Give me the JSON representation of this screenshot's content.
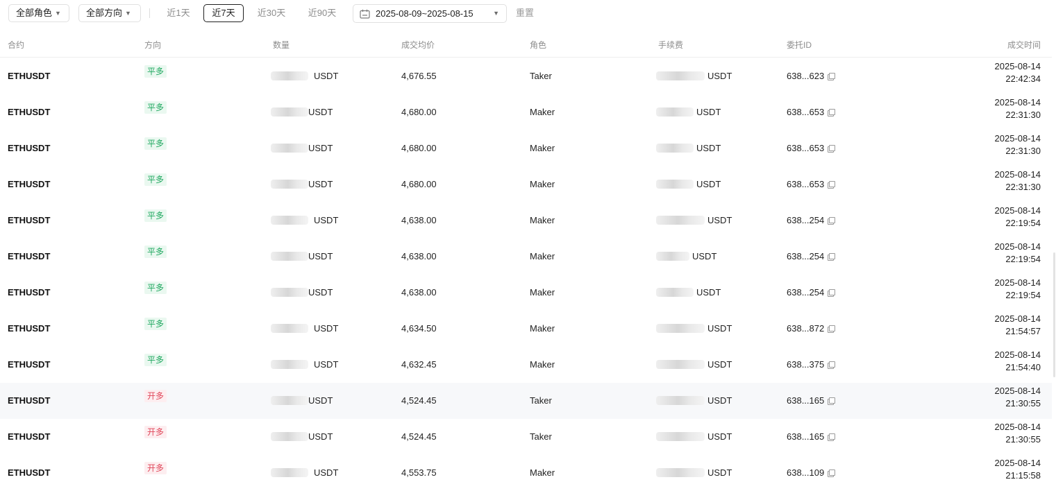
{
  "filters": {
    "role": "全部角色",
    "direction": "全部方向",
    "quick_ranges": [
      "近1天",
      "近7天",
      "近30天",
      "近90天"
    ],
    "active_range": "近7天",
    "date_range": "2025-08-09~2025-08-15",
    "reset": "重置"
  },
  "columns": [
    "合约",
    "方向",
    "数量",
    "成交均价",
    "角色",
    "手续费",
    "委托ID",
    "成交时间"
  ],
  "rows": [
    {
      "contract": "ETHUSDT",
      "side": "平多",
      "qty_visible": "USDT",
      "price": "4,676.55",
      "role": "Taker",
      "fee_visible": "USDT",
      "order_id": "638...623",
      "date": "2025-08-14",
      "time": "22:42:34"
    },
    {
      "contract": "ETHUSDT",
      "side": "平多",
      "qty_visible": "USDT",
      "price": "4,680.00",
      "role": "Maker",
      "fee_visible": "USDT",
      "order_id": "638...653",
      "date": "2025-08-14",
      "time": "22:31:30"
    },
    {
      "contract": "ETHUSDT",
      "side": "平多",
      "qty_visible": "USDT",
      "price": "4,680.00",
      "role": "Maker",
      "fee_visible": "USDT",
      "order_id": "638...653",
      "date": "2025-08-14",
      "time": "22:31:30"
    },
    {
      "contract": "ETHUSDT",
      "side": "平多",
      "qty_visible": "USDT",
      "price": "4,680.00",
      "role": "Maker",
      "fee_visible": "USDT",
      "order_id": "638...653",
      "date": "2025-08-14",
      "time": "22:31:30"
    },
    {
      "contract": "ETHUSDT",
      "side": "平多",
      "qty_visible": "USDT",
      "price": "4,638.00",
      "role": "Maker",
      "fee_visible": "USDT",
      "order_id": "638...254",
      "date": "2025-08-14",
      "time": "22:19:54"
    },
    {
      "contract": "ETHUSDT",
      "side": "平多",
      "qty_visible": "USDT",
      "price": "4,638.00",
      "role": "Maker",
      "fee_visible": "USDT",
      "order_id": "638...254",
      "date": "2025-08-14",
      "time": "22:19:54"
    },
    {
      "contract": "ETHUSDT",
      "side": "平多",
      "qty_visible": "USDT",
      "price": "4,638.00",
      "role": "Maker",
      "fee_visible": "USDT",
      "order_id": "638...254",
      "date": "2025-08-14",
      "time": "22:19:54"
    },
    {
      "contract": "ETHUSDT",
      "side": "平多",
      "qty_visible": "USDT",
      "price": "4,634.50",
      "role": "Maker",
      "fee_visible": "USDT",
      "order_id": "638...872",
      "date": "2025-08-14",
      "time": "21:54:57"
    },
    {
      "contract": "ETHUSDT",
      "side": "平多",
      "qty_visible": "USDT",
      "price": "4,632.45",
      "role": "Maker",
      "fee_visible": "USDT",
      "order_id": "638...375",
      "date": "2025-08-14",
      "time": "21:54:40"
    },
    {
      "contract": "ETHUSDT",
      "side": "开多",
      "qty_visible": "USDT",
      "price": "4,524.45",
      "role": "Taker",
      "fee_visible": "USDT",
      "order_id": "638...165",
      "date": "2025-08-14",
      "time": "21:30:55"
    },
    {
      "contract": "ETHUSDT",
      "side": "开多",
      "qty_visible": "USDT",
      "price": "4,524.45",
      "role": "Taker",
      "fee_visible": "USDT",
      "order_id": "638...165",
      "date": "2025-08-14",
      "time": "21:30:55"
    },
    {
      "contract": "ETHUSDT",
      "side": "开多",
      "qty_visible": "USDT",
      "price": "4,553.75",
      "role": "Maker",
      "fee_visible": "USDT",
      "order_id": "638...109",
      "date": "2025-08-14",
      "time": "21:15:58"
    }
  ],
  "highlighted_row": 9,
  "colors": {
    "close_long": "#1fa85f",
    "open_long": "#e0475a",
    "active_border": "#1f1f1f",
    "muted": "#8c8c8c"
  }
}
